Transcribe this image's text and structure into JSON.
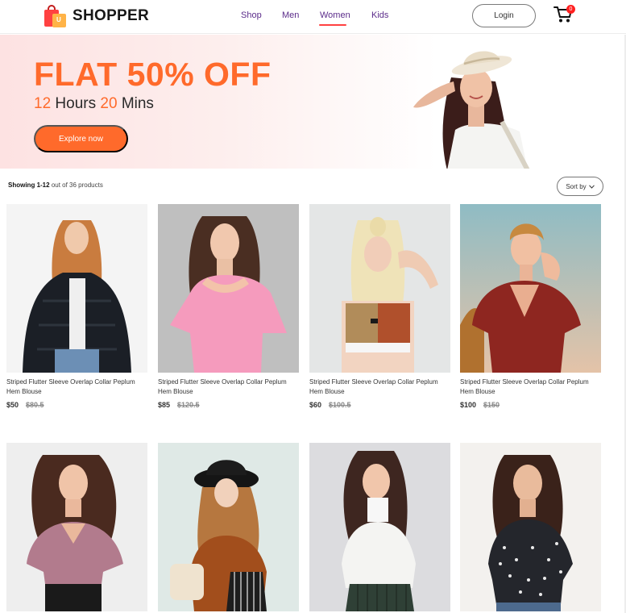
{
  "brand": {
    "name": "SHOPPER"
  },
  "nav": {
    "items": [
      {
        "label": "Shop"
      },
      {
        "label": "Men"
      },
      {
        "label": "Women"
      },
      {
        "label": "Kids"
      }
    ],
    "active": "Women",
    "login_label": "Login",
    "cart_count": "0"
  },
  "hero": {
    "title": "FLAT 50% OFF",
    "hours_value": "12",
    "hours_label": "Hours",
    "mins_value": "20",
    "mins_label": "Mins",
    "button_label": "Explore now"
  },
  "toolbar": {
    "showing_prefix": "Showing",
    "showing_range": "1-12",
    "showing_suffix": "out of 36 products",
    "sort_label": "Sort by"
  },
  "products": [
    {
      "name": "Striped Flutter Sleeve Overlap Collar Peplum Hem Blouse",
      "price": "$50",
      "old_price": "$80.5"
    },
    {
      "name": "Striped Flutter Sleeve Overlap Collar Peplum Hem Blouse",
      "price": "$85",
      "old_price": "$120.5"
    },
    {
      "name": "Striped Flutter Sleeve Overlap Collar Peplum Hem Blouse",
      "price": "$60",
      "old_price": "$100.5"
    },
    {
      "name": "Striped Flutter Sleeve Overlap Collar Peplum Hem Blouse",
      "price": "$100",
      "old_price": "$150"
    }
  ],
  "colors": {
    "accent": "#ff6a2b",
    "nav_text": "#5b2c8a",
    "active_underline": "#ff4141",
    "badge": "#ff2020"
  }
}
